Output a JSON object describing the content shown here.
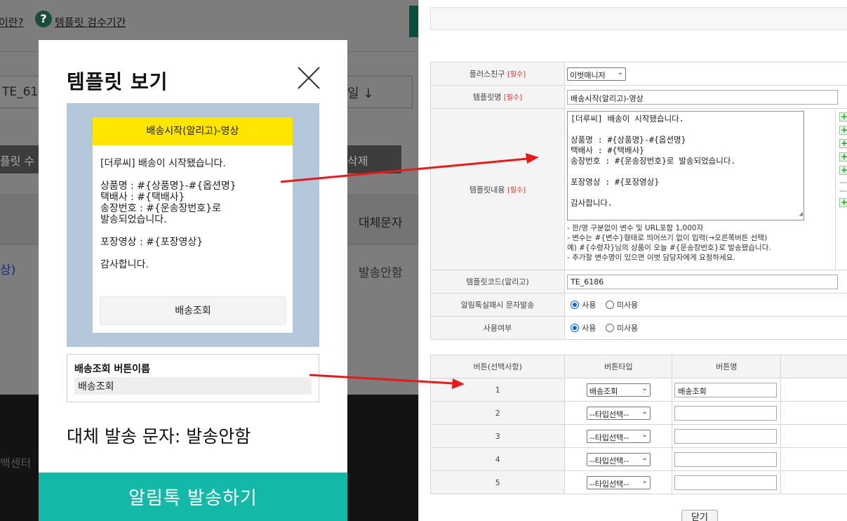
{
  "background": {
    "link_1": "이란?",
    "help_icon": "?",
    "help_link": "템플릿 검수기간",
    "input_value": "TE_61",
    "select_value": "일 ↓",
    "button_1": "플릿 수",
    "button_2": "삭제",
    "column_header": "대체문자",
    "row_link": "상)",
    "row_value": "발송안함",
    "footer_text": "백센터"
  },
  "modal": {
    "title": "템플릿 보기",
    "close_icon": "close-icon",
    "message": {
      "header": "배송시작(알리고)-영상",
      "body": "[더루씨] 배송이 시작됐습니다.\n\n상품명 : #{상품명}-#{옵션명}\n택배사 : #{택배사}\n송장번호 : #{운송장번호}로 발송되었습니다.\n\n포장영상 : #{포장영상}\n\n감사합니다.",
      "button": "배송조회"
    },
    "button_name_label": "배송조회 버튼이름",
    "button_name_value": "배송조회",
    "fallback_text": "대체 발송 문자: 발송안함",
    "send_button": "알림톡 발송하기"
  },
  "form": {
    "required_tag": "[필수]",
    "plusfriend": {
      "label": "플러스친구",
      "value": "이벗매니저"
    },
    "template_name": {
      "label": "템플릿명",
      "value": "배송시작(알리고)-영상"
    },
    "template_content": {
      "label": "템플릿내용",
      "value": "[더루씨] 배송이 시작됐습니다.\n\n상품명 : #{상품명}-#{옵션명}\n택배사 : #{택배사}\n송장번호 : #{운송장번호}로 발송되었습니다.\n\n포장영상 : #{포장영상}\n\n감사합니다.",
      "help_lines": [
        "- 한/영 구분없이 변수 및 URL포함 1,000자",
        "- 변수는 #{변수}형태로 띄어쓰기 없이 입력(→오른쪽버튼 선택)",
        "예) #{수령자}님의 상품이 오늘 #{운송장번호}로 발송됐습니다.",
        "- 추가할 변수명이 있으면 이벗 담당자에게 요청하세요."
      ]
    },
    "template_code": {
      "label": "템플릿코드(알리고)",
      "value": "TE_6186"
    },
    "fail_sms": {
      "label": "알림톡실패시 문자발송",
      "options": [
        "사용",
        "미사용"
      ],
      "selected": "사용"
    },
    "use_yn": {
      "label": "사용여부",
      "options": [
        "사용",
        "미사용"
      ],
      "selected": "사용"
    },
    "buttons_table": {
      "headers": [
        "버튼(선택사항)",
        "버튼타입",
        "버튼명"
      ],
      "rows": [
        {
          "no": "1",
          "type": "배송조회",
          "name": "배송조회"
        },
        {
          "no": "2",
          "type": "--타입선택--",
          "name": ""
        },
        {
          "no": "3",
          "type": "--타입선택--",
          "name": ""
        },
        {
          "no": "4",
          "type": "--타입선택--",
          "name": ""
        },
        {
          "no": "5",
          "type": "--타입선택--",
          "name": ""
        }
      ]
    },
    "close_button": "닫기"
  },
  "colors": {
    "send_button": "#14b8a6",
    "message_header": "#fee500",
    "preview_bg": "#b2c7d9",
    "arrow": "#e8191a"
  }
}
